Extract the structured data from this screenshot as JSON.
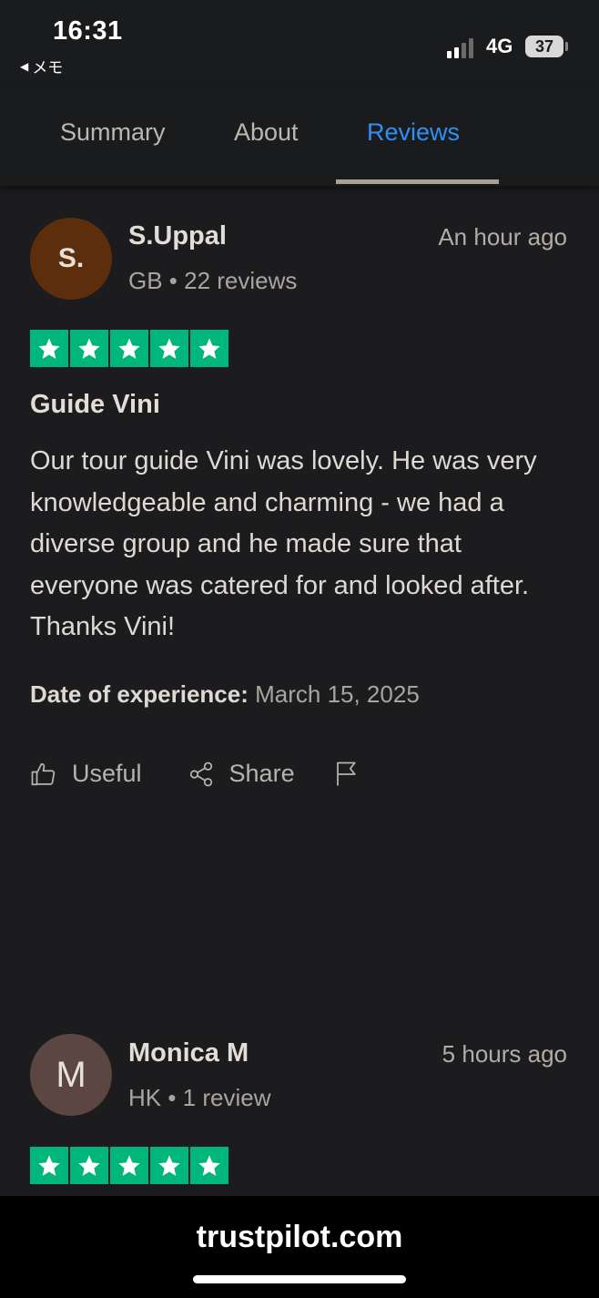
{
  "status_bar": {
    "time": "16:31",
    "back_app": "メモ",
    "network": "4G",
    "battery": "37"
  },
  "tabs": [
    {
      "label": "Summary",
      "active": false
    },
    {
      "label": "About",
      "active": false
    },
    {
      "label": "Reviews",
      "active": true
    }
  ],
  "reviews": [
    {
      "initials": "S.",
      "avatar_color": "#5d2e0c",
      "name": "S.Uppal",
      "meta": "GB • 22 reviews",
      "time_ago": "An hour ago",
      "stars": 5,
      "title": "Guide Vini",
      "body": "Our tour guide Vini was lovely. He was very knowledgeable and charming - we had a diverse group and he made sure that everyone was catered for and looked after. Thanks Vini!",
      "date_label": "Date of experience:",
      "date_value": "March 15, 2025",
      "actions": {
        "useful": "Useful",
        "share": "Share"
      }
    },
    {
      "initials": "M",
      "avatar_color": "#5b4642",
      "name": "Monica M",
      "meta": "HK • 1 review",
      "time_ago": "5 hours ago",
      "stars": 5
    }
  ],
  "star_color": "#00b67a",
  "accent_color": "#2f8ff5",
  "bottom_bar": {
    "url": "trustpilot.com"
  }
}
